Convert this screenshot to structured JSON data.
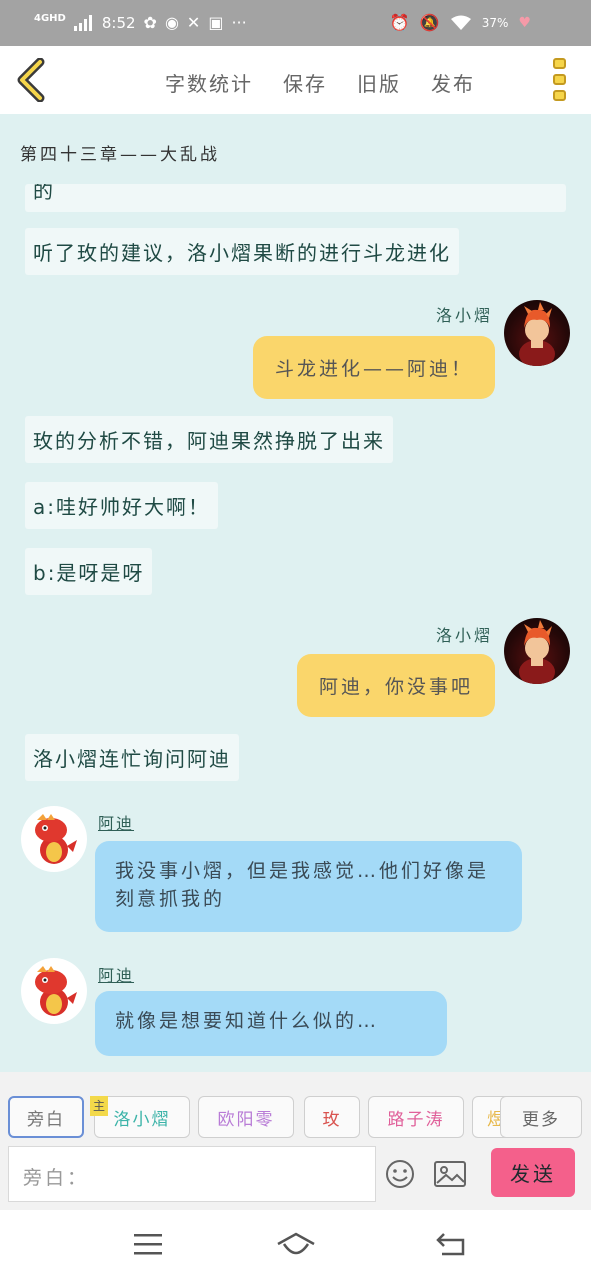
{
  "status_bar": {
    "network": "4GHD",
    "time": "8:52",
    "battery": "37%"
  },
  "toolbar": {
    "word_count": "字数统计",
    "save": "保存",
    "old_version": "旧版",
    "publish": "发布"
  },
  "chapter_title": "第四十三章——大乱战",
  "messages": [
    {
      "type": "narration",
      "text": "的"
    },
    {
      "type": "narration",
      "text": "听了玫的建议，洛小熠果断的进行斗龙进化"
    },
    {
      "type": "right",
      "name": "洛小熠",
      "text": "斗龙进化——阿迪！"
    },
    {
      "type": "narration",
      "text": "玫的分析不错，阿迪果然挣脱了出来"
    },
    {
      "type": "narration",
      "text": "a:哇好帅好大啊！"
    },
    {
      "type": "narration",
      "text": "b:是呀是呀"
    },
    {
      "type": "right",
      "name": "洛小熠",
      "text": "阿迪，你没事吧"
    },
    {
      "type": "narration",
      "text": "洛小熠连忙询问阿迪"
    },
    {
      "type": "left",
      "name": "阿迪",
      "text": "我没事小熠，但是我感觉…他们好像是刻意抓我的"
    },
    {
      "type": "left",
      "name": "阿迪",
      "text": "就像是想要知道什么似的…"
    }
  ],
  "role_chips": [
    {
      "label": "旁白",
      "color": "#777777"
    },
    {
      "label": "洛小熠",
      "color": "#3bb3a8"
    },
    {
      "label": "欧阳零",
      "color": "#b87bd6"
    },
    {
      "label": "玫",
      "color": "#d9534f"
    },
    {
      "label": "路子涛",
      "color": "#e0609a"
    },
    {
      "label": "煜",
      "color": "#e7b84a"
    }
  ],
  "main_tag": "主",
  "more_chip": "更多",
  "input": {
    "placeholder": "旁白："
  },
  "send_label": "发送",
  "colors": {
    "chat_bg": "#dff1f1",
    "right_bubble": "#fad66b",
    "left_bubble": "#a4daf7",
    "send_button": "#f4608b"
  }
}
